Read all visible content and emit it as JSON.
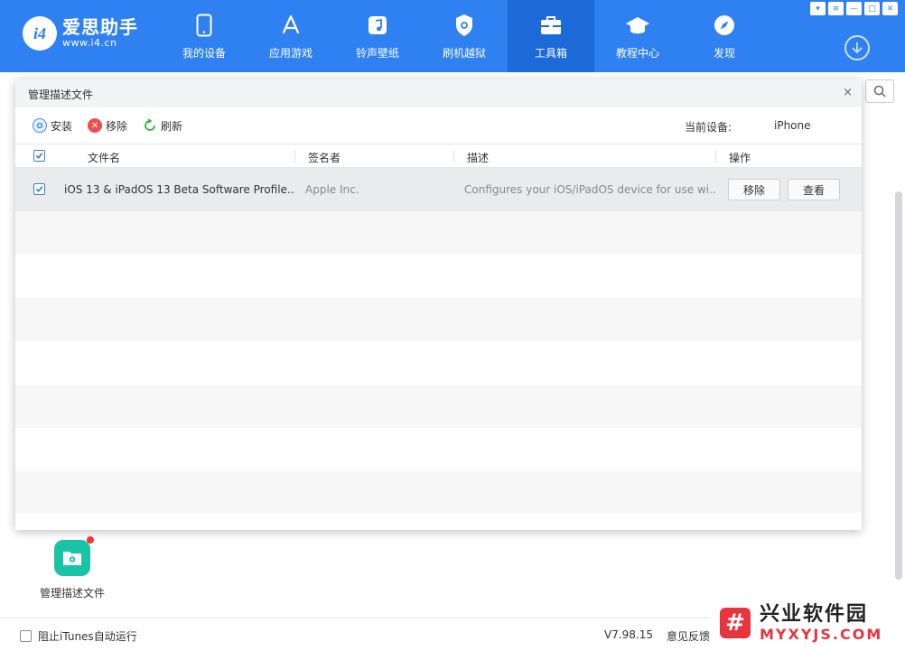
{
  "app": {
    "logo_badge": "i4",
    "logo_title": "爱思助手",
    "logo_url": "www.i4.cn"
  },
  "nav": [
    {
      "label": "我的设备",
      "icon": "phone-icon"
    },
    {
      "label": "应用游戏",
      "icon": "app-store-icon"
    },
    {
      "label": "铃声壁纸",
      "icon": "music-note-icon"
    },
    {
      "label": "刷机越狱",
      "icon": "shield-icon"
    },
    {
      "label": "工具箱",
      "icon": "toolbox-icon",
      "active": true
    },
    {
      "label": "教程中心",
      "icon": "graduation-cap-icon"
    },
    {
      "label": "发现",
      "icon": "compass-icon"
    }
  ],
  "dialog": {
    "title": "管理描述文件",
    "close": "×",
    "toolbar": {
      "install": "安装",
      "remove": "移除",
      "refresh": "刷新",
      "device_label": "当前设备:",
      "device_value": "iPhone"
    },
    "columns": {
      "filename": "文件名",
      "signer": "签名者",
      "description": "描述",
      "action": "操作"
    },
    "rows": [
      {
        "checked": true,
        "filename": "iOS 13 & iPadOS 13 Beta Software Profile...",
        "signer": "Apple Inc.",
        "description": "Configures your iOS/iPadOS device for use wi...",
        "remove_label": "移除",
        "view_label": "查看"
      }
    ]
  },
  "tool_tile": {
    "label": "管理描述文件"
  },
  "status": {
    "itunes_label": "阻止iTunes自动运行",
    "version": "V7.98.15",
    "feedback": "意见反馈"
  },
  "watermark": {
    "title": "兴业软件园",
    "sub": "MYXYJS.COM"
  },
  "colors": {
    "brand": "#2f80f0",
    "active_nav": "#1c6ad8",
    "tool_icon": "#19c4a6"
  }
}
